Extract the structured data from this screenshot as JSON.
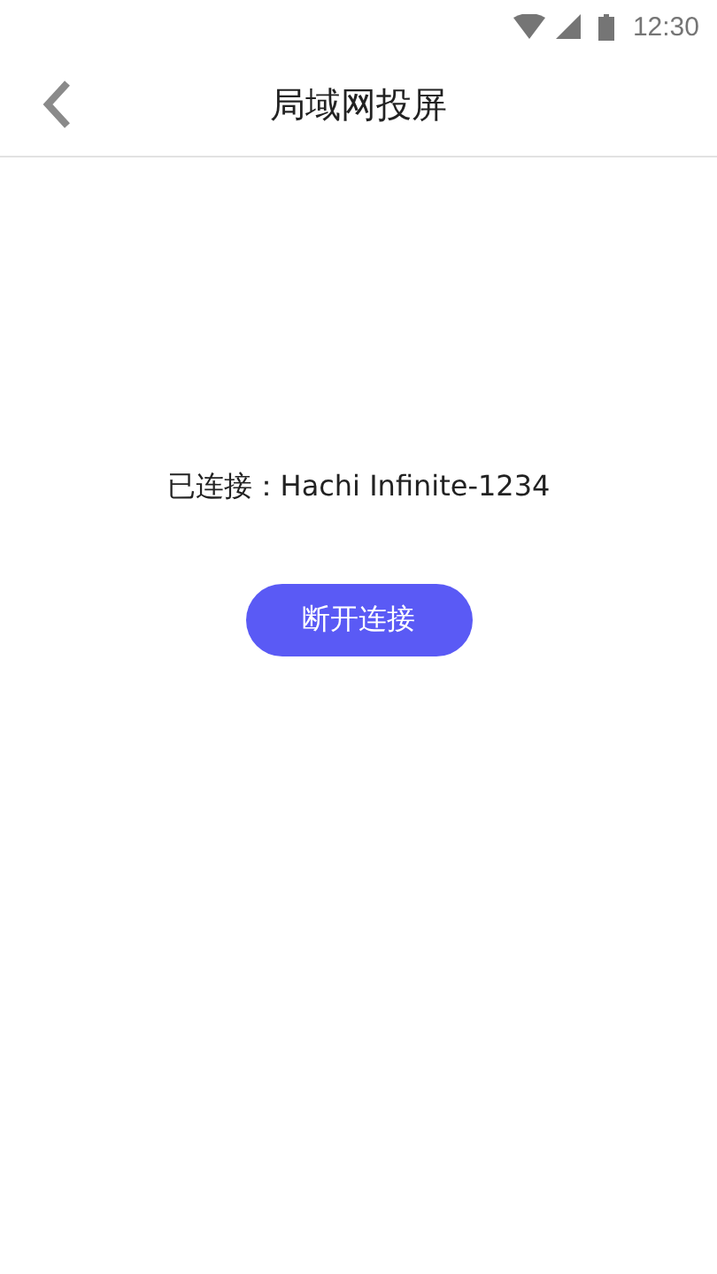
{
  "status_bar": {
    "time": "12:30"
  },
  "header": {
    "title": "局域网投屏"
  },
  "connection": {
    "status": "已连接：Hachi Infinite-1234"
  },
  "buttons": [
    {
      "label": "断开连接"
    }
  ]
}
